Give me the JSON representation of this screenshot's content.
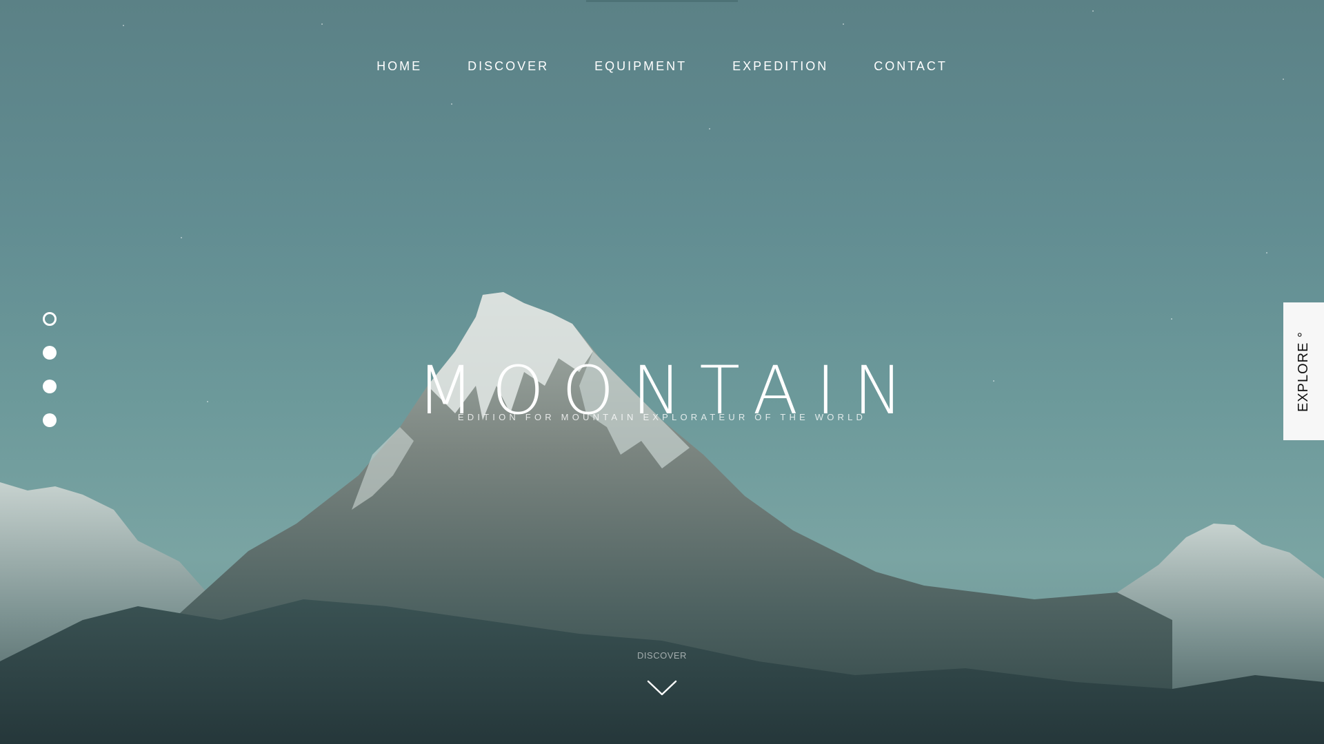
{
  "nav": {
    "items": [
      {
        "label": "HOME"
      },
      {
        "label": "DISCOVER"
      },
      {
        "label": "EQUIPMENT"
      },
      {
        "label": "EXPEDITION"
      },
      {
        "label": "CONTACT"
      }
    ]
  },
  "hero": {
    "title": "MOONTAIN",
    "subtitle": "EDITION FOR MOUNTAIN EXPLORATEUR OF THE WORLD"
  },
  "slider": {
    "total": 4,
    "active_index": 0
  },
  "explore_tab": {
    "label": "EXPLORE °"
  },
  "scroll": {
    "label": "DISCOVER",
    "icon": "chevron-down-icon"
  },
  "colors": {
    "sky_top": "#5b8186",
    "sky_mid": "#6d9a9b",
    "snow": "#e6ece9",
    "rock_dark": "#2e4244",
    "text": "#ffffff"
  }
}
